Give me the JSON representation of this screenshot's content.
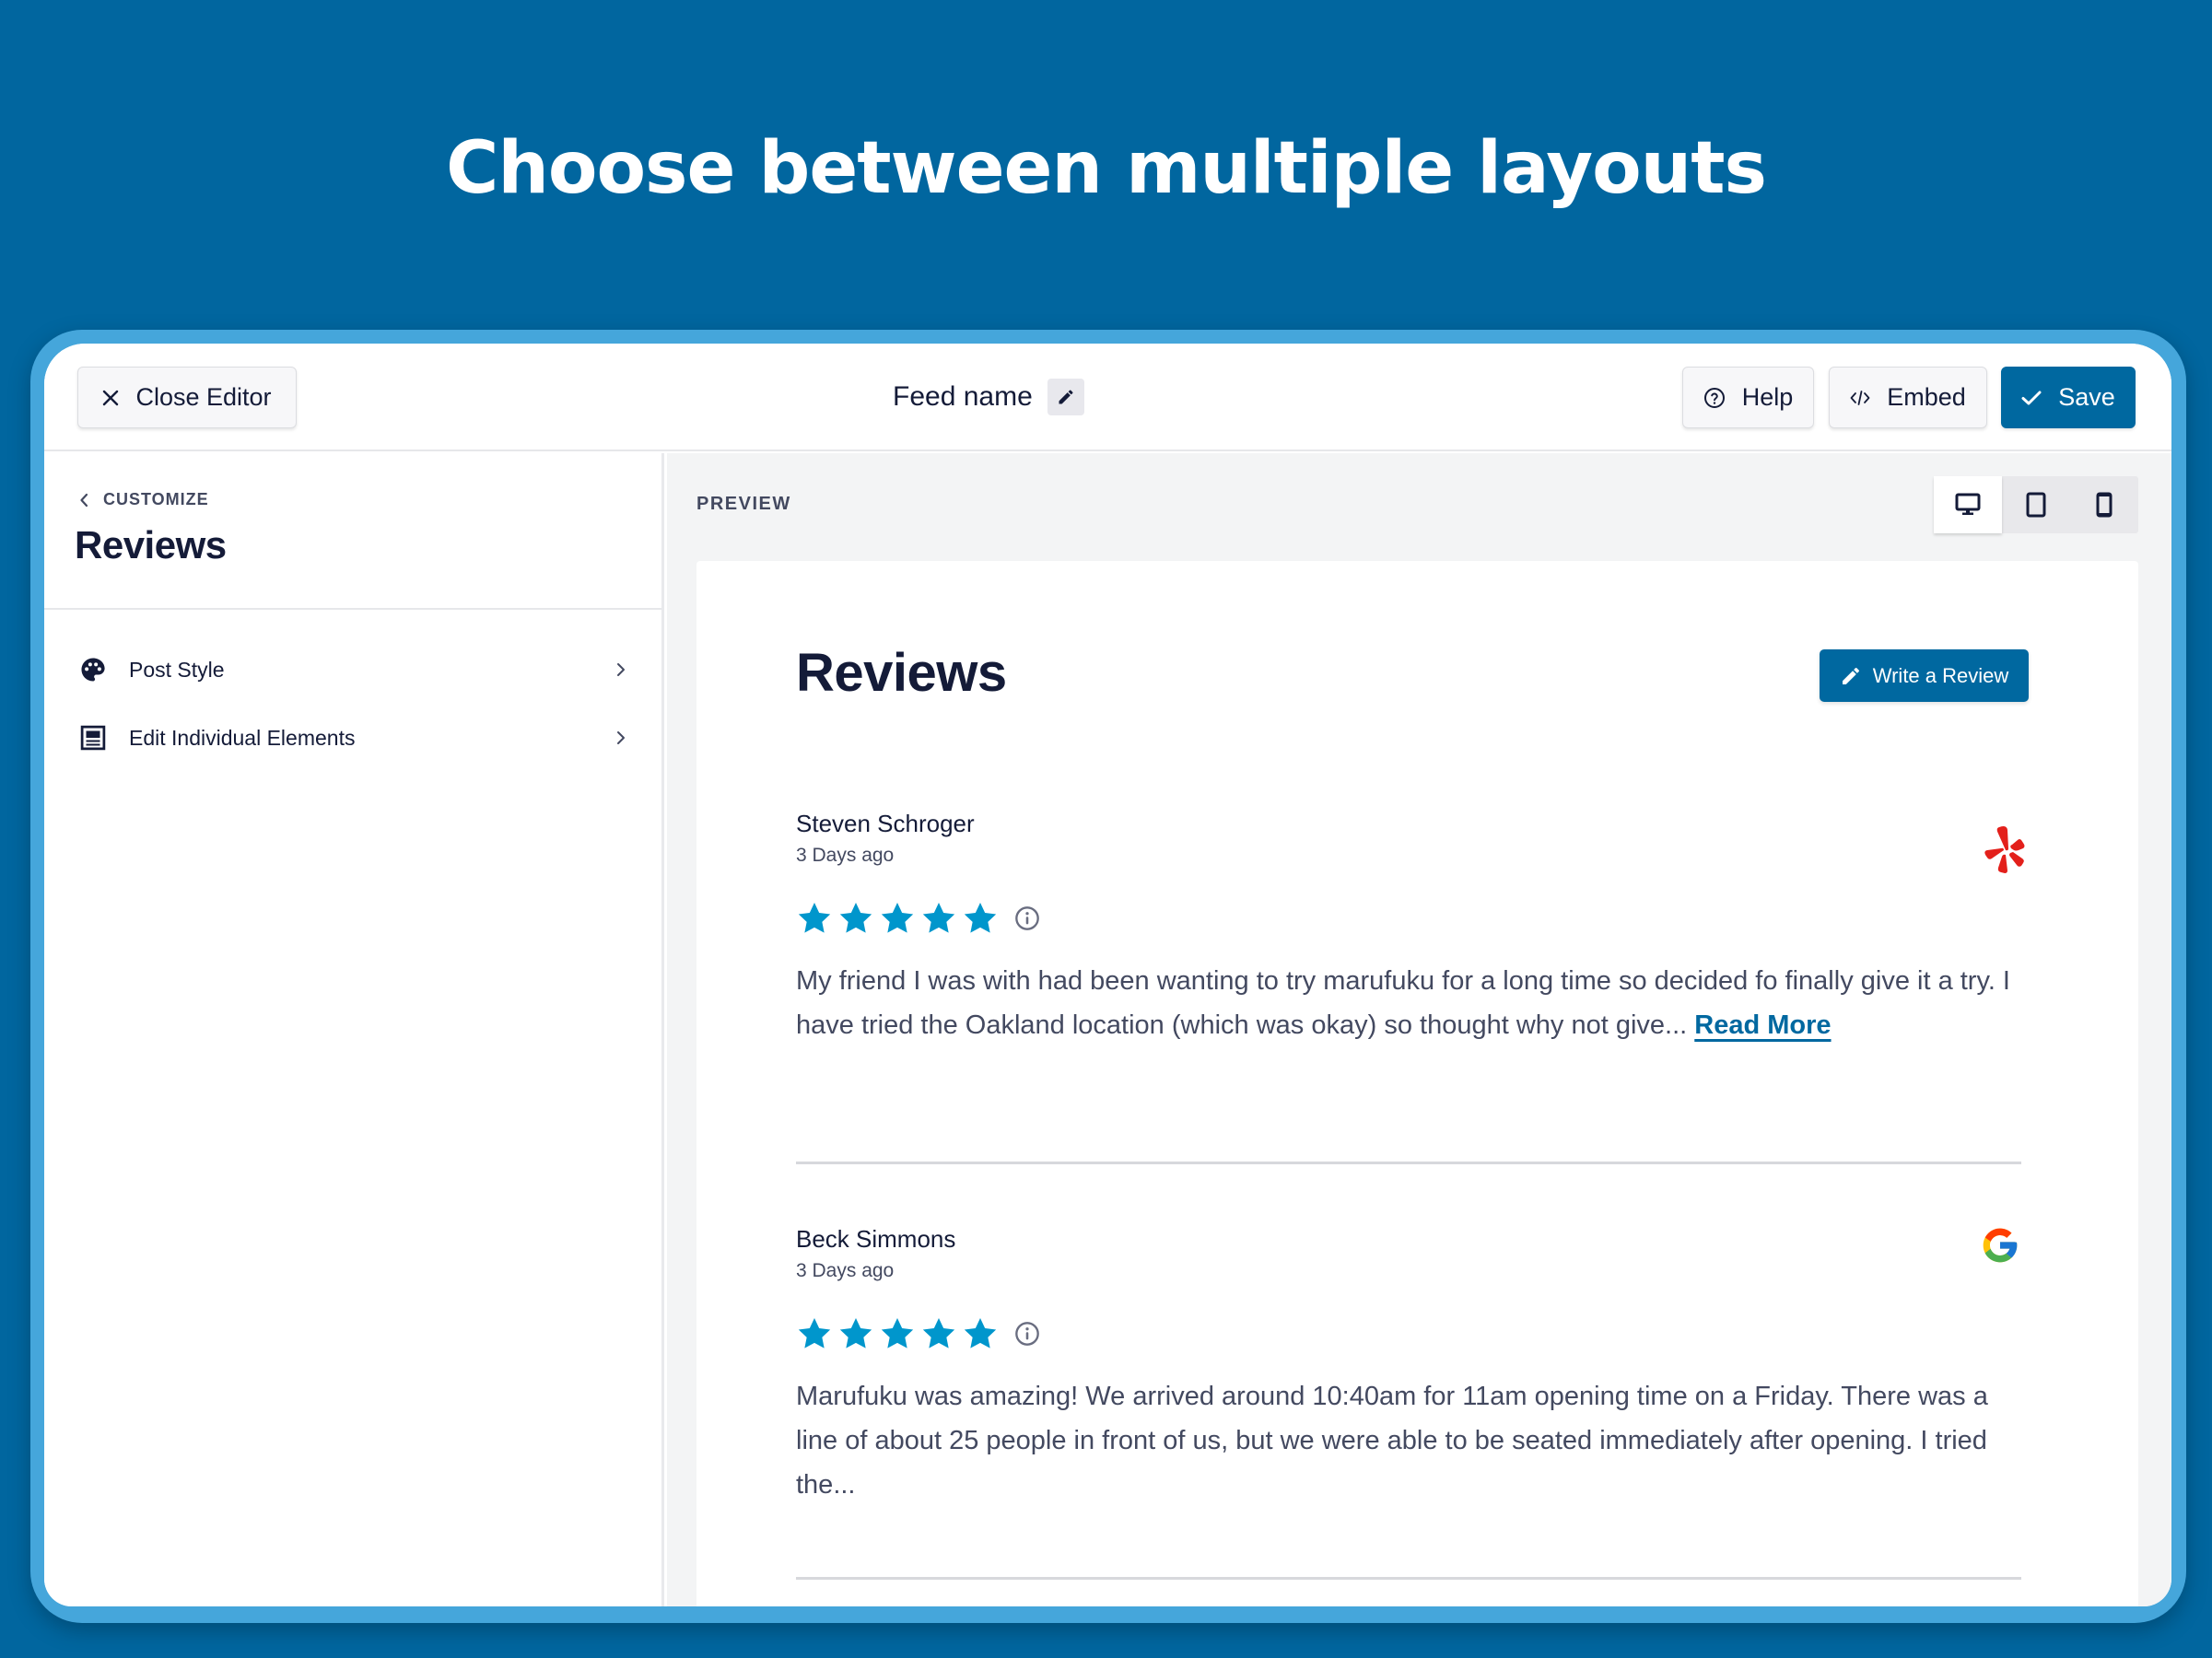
{
  "headline": "Choose between multiple layouts",
  "topbar": {
    "close_label": "Close Editor",
    "feed_name": "Feed name",
    "help_label": "Help",
    "embed_label": "Embed",
    "save_label": "Save"
  },
  "sidebar": {
    "breadcrumb": "CUSTOMIZE",
    "title": "Reviews",
    "items": [
      {
        "label": "Post Style",
        "icon": "palette-icon"
      },
      {
        "label": "Edit Individual Elements",
        "icon": "layout-icon"
      }
    ]
  },
  "preview": {
    "label": "PREVIEW",
    "devices": [
      {
        "name": "desktop",
        "active": true
      },
      {
        "name": "tablet",
        "active": false
      },
      {
        "name": "mobile",
        "active": false
      }
    ],
    "feed": {
      "title": "Reviews",
      "write_review_label": "Write a Review",
      "reviews": [
        {
          "author": "Steven Schroger",
          "date": "3 Days ago",
          "rating": 5,
          "source": "yelp",
          "text": "My friend I was with had been wanting to try marufuku for a long time so decided fo finally give it a try. I have tried the Oakland location (which was okay) so thought why not give...",
          "read_more": "Read More"
        },
        {
          "author": "Beck Simmons",
          "date": "3 Days ago",
          "rating": 5,
          "source": "google",
          "text": "Marufuku was amazing! We arrived around 10:40am for 11am opening time on a Friday. There was a line of about 25 people in front of us, but we were able to be seated immediately after opening. I tried the...",
          "read_more": ""
        }
      ]
    }
  },
  "colors": {
    "background": "#01669f",
    "frame": "#45a6db",
    "primary": "#0068a0",
    "star": "#0096cc",
    "text_dark": "#141b38",
    "text_muted": "#434960",
    "yelp": "#e3201b"
  }
}
